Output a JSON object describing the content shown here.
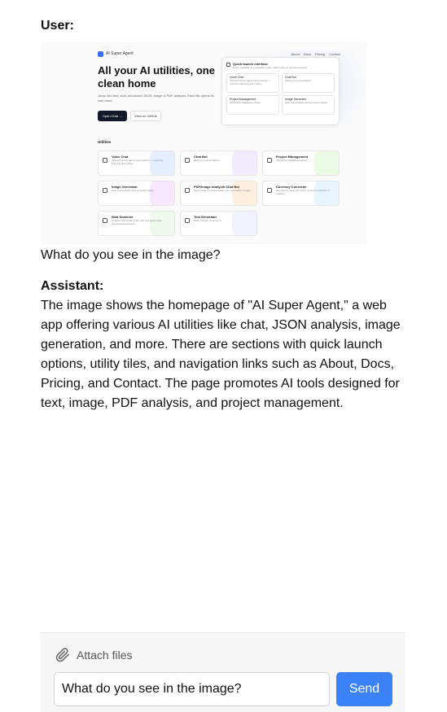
{
  "conversation": {
    "user": {
      "role_label": "User:",
      "text": "What do you see in the image?"
    },
    "assistant": {
      "role_label": "Assistant:",
      "text": "The image shows the homepage of \"AI Super Agent,\" a web app offering various AI utilities like chat, JSON analysis, image generation, and more. There are sections with quick launch options, utility tiles, and navigation links such as About, Docs, Pricing, and Contact. The page promotes AI tools designed for text, image, PDF analysis, and project management."
    }
  },
  "screenshot": {
    "brand": "AI Super Agent",
    "nav": [
      "About",
      "Docs",
      "Pricing",
      "Contact"
    ],
    "hero_title": "All your AI utilities, one clean home",
    "hero_subtitle": "Jump into text, chat, structured JSON, image & PDF analysis. Each file opens its own route.",
    "primary_button": "Open Chat →",
    "secondary_button": "View on GitHub",
    "quick_launch": {
      "title": "Quick launch interface",
      "subtitle": "Every capability in a separate route—add a page to the last launcher.",
      "items": [
        {
          "title": "Voice Chat",
          "desc": "Talk with the AI agent using speech — real-time listening and replies."
        },
        {
          "title": "Chat Bot",
          "desc": "Multi-turn conversations."
        },
        {
          "title": "Project Management",
          "desc": "JSON-first validated outputs."
        },
        {
          "title": "Image Generator",
          "desc": "Give a description and generate image."
        }
      ]
    },
    "utilities_label": "Utilities",
    "utilities": [
      {
        "title": "Voice Chat",
        "desc": "Talk with the AI agent using speech — real-time listening and replies.",
        "color": "#cfe0ff"
      },
      {
        "title": "Chat Bot",
        "desc": "Multi-turn conversations.",
        "color": "#e9dcff"
      },
      {
        "title": "Project Management",
        "desc": "JSON-first validated outputs.",
        "color": "#d9f5d0"
      },
      {
        "title": "Image Generator",
        "desc": "Give a description and generate image.",
        "color": "#f3d6ff"
      },
      {
        "title": "PDF/Image Analysis Chat Bot",
        "desc": "Send image & extract tables, list, summarize images.",
        "color": "#ffe2c4"
      },
      {
        "title": "Currency Converter",
        "desc": "Example of using API Tools: convert currencies in realtime.",
        "color": "#d3ecff"
      },
      {
        "title": "Web Searcher",
        "desc": "AI agent that looks up the web and gives clear, summarized answers.",
        "color": "#e0f6dc"
      },
      {
        "title": "Text Generator",
        "desc": "Draft, rewrite, summarize.",
        "color": "#e5e7ff"
      }
    ]
  },
  "composer": {
    "attach_label": "Attach files",
    "input_value": "What do you see in the image?",
    "send_label": "Send"
  }
}
